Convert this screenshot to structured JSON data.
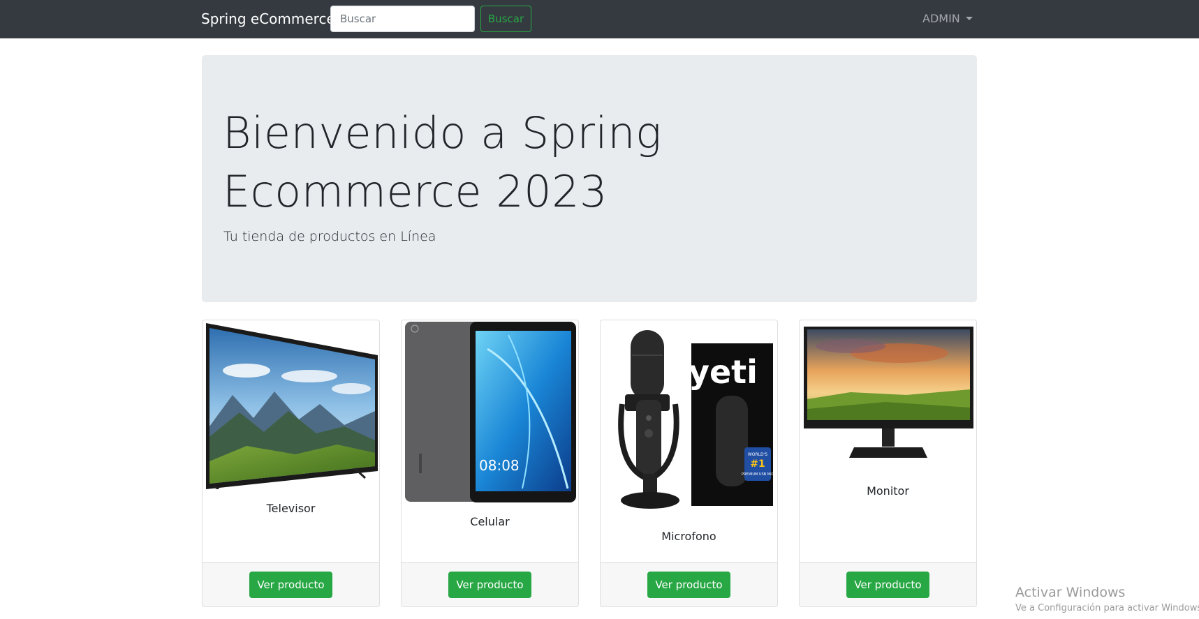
{
  "navbar": {
    "brand": "Spring eCommerce",
    "search_placeholder": "Buscar",
    "search_button": "Buscar",
    "user_menu": "ADMIN"
  },
  "jumbotron": {
    "title": "Bienvenido a Spring Ecommerce 2023",
    "lead": "Tu tienda de productos en Línea"
  },
  "products": [
    {
      "name": "Televisor",
      "button": "Ver producto"
    },
    {
      "name": "Celular",
      "button": "Ver producto"
    },
    {
      "name": "Microfono",
      "button": "Ver producto"
    },
    {
      "name": "Monitor",
      "button": "Ver producto"
    }
  ],
  "product_images": {
    "televisor": "tv-image",
    "celular": "tablet-image",
    "microfono": "microphone-image",
    "monitor": "monitor-image",
    "tablet_clock": "08:08",
    "mic_box_brand": "yeti",
    "mic_box_badge_top": "WORLD'S",
    "mic_box_badge_num": "#1",
    "mic_box_badge_bottom": "PREMIUM USB MIC"
  },
  "os_watermark": {
    "title": "Activar Windows",
    "subtitle": "Ve a Configuración para activar Windows."
  },
  "colors": {
    "navbar": "#343a40",
    "jumbotron": "#e9ecef",
    "success": "#28a745"
  }
}
